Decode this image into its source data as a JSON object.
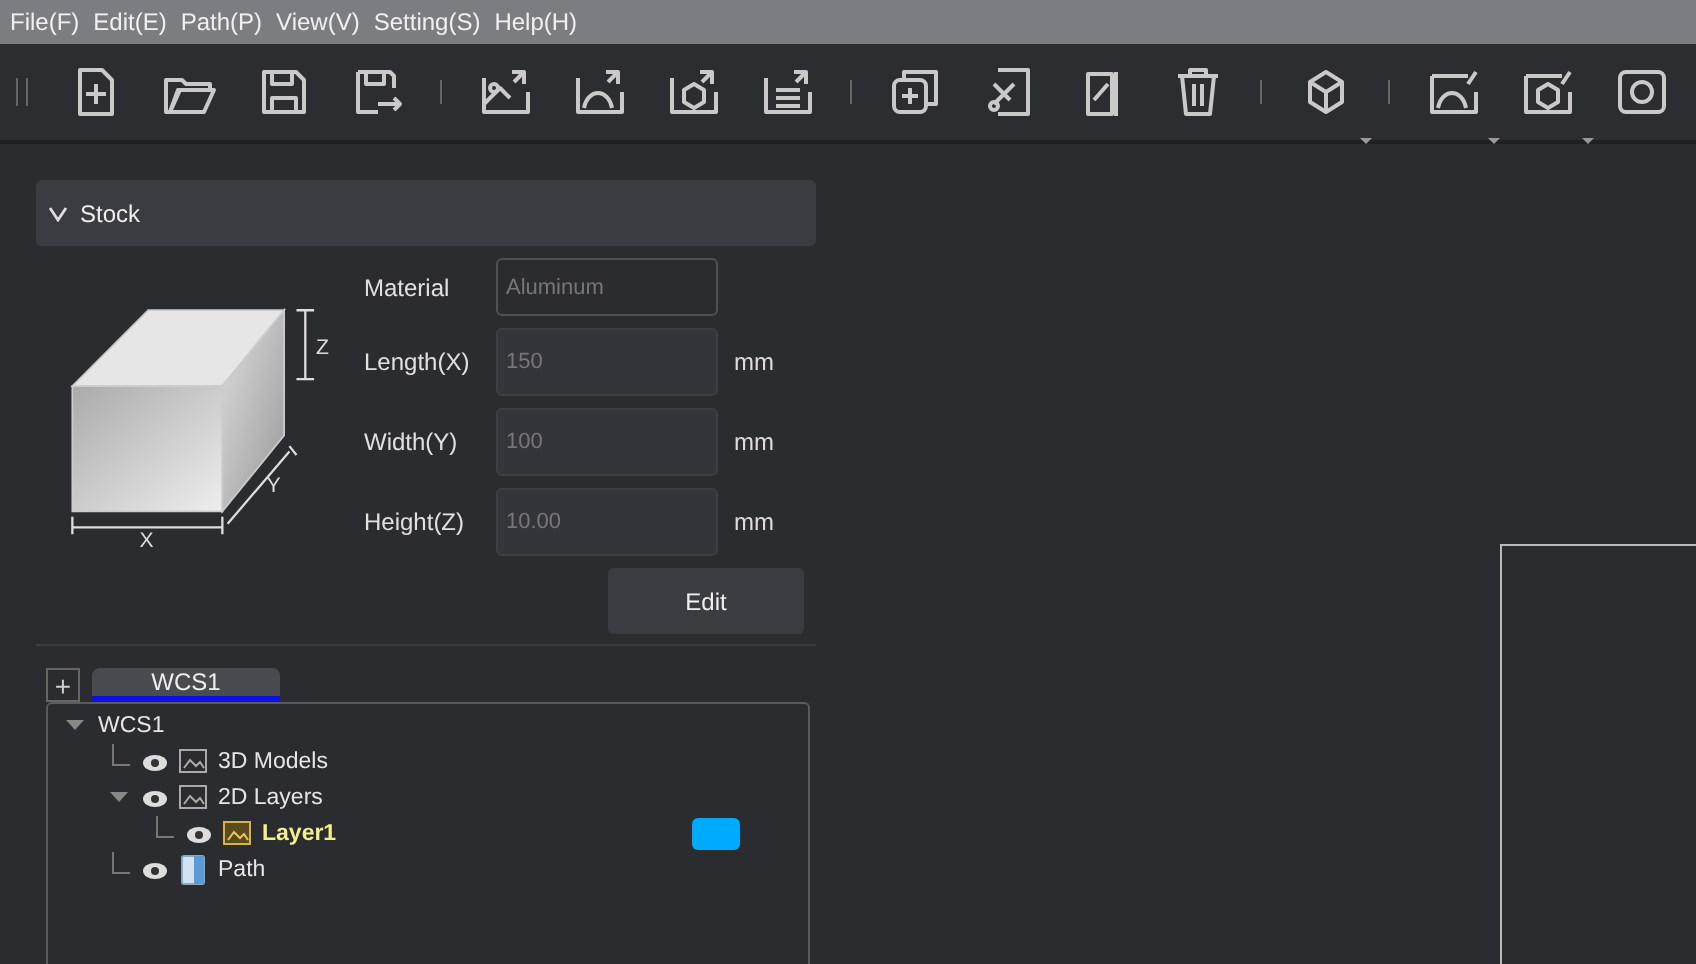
{
  "menu": [
    "File(F)",
    "Edit(E)",
    "Path(P)",
    "View(V)",
    "Setting(S)",
    "Help(H)"
  ],
  "stock": {
    "title": "Stock",
    "expanded": true,
    "fields": [
      {
        "label": "Material",
        "value": "Aluminum",
        "disabled": true
      },
      {
        "label": "Length(X)",
        "value": "150",
        "unit": "mm",
        "disabled": true
      },
      {
        "label": "Width(Y)",
        "value": "100",
        "unit": "mm",
        "disabled": true
      },
      {
        "label": "Height(Z)",
        "value": "10.00",
        "unit": "mm",
        "disabled": true
      }
    ],
    "axes": {
      "x": "X",
      "y": "Y",
      "z": "Z"
    },
    "edit_button": "Edit"
  },
  "wcs_tabs": {
    "add": "+",
    "tabs": [
      {
        "label": "WCS1",
        "selected": true
      }
    ]
  },
  "tree": [
    {
      "label": "WCS1",
      "expanded": true,
      "children": [
        {
          "label": "3D Models",
          "kind": "model",
          "visible": true,
          "selected": false
        },
        {
          "label": "2D Layers",
          "kind": "layers",
          "visible": true,
          "selected": false,
          "expanded": true,
          "children": [
            {
              "label": "Layer1",
              "kind": "layer",
              "visible": true,
              "selected": true,
              "color": "#00aaff"
            }
          ]
        },
        {
          "label": "Path",
          "kind": "path",
          "visible": true,
          "selected": false
        }
      ]
    }
  ]
}
